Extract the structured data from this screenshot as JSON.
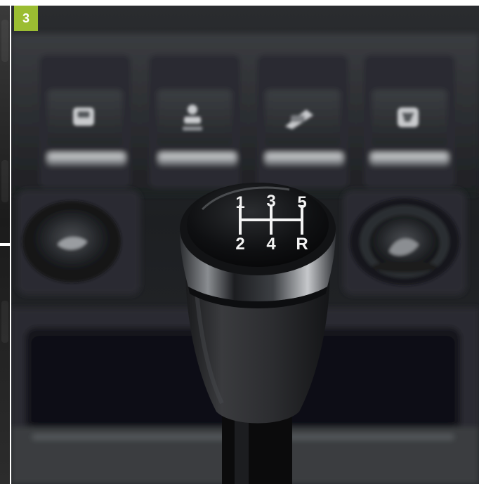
{
  "badge": {
    "number": "3",
    "color": "#9bbd32"
  },
  "gear_pattern": {
    "top_row": [
      "1",
      "3",
      "5"
    ],
    "bottom_row": [
      "2",
      "4",
      "R"
    ]
  },
  "switch_icons": [
    "traction-control-icon",
    "hill-hold-icon",
    "descent-control-icon",
    "lamp-icon"
  ],
  "side_controls": [
    "left-round-switch",
    "right-round-switch"
  ],
  "colors": {
    "background": "#1b1d20",
    "knob_cap": "#0f1012",
    "knob_rubber": "#2b2c2f",
    "engraving": "#f3f3f3"
  }
}
